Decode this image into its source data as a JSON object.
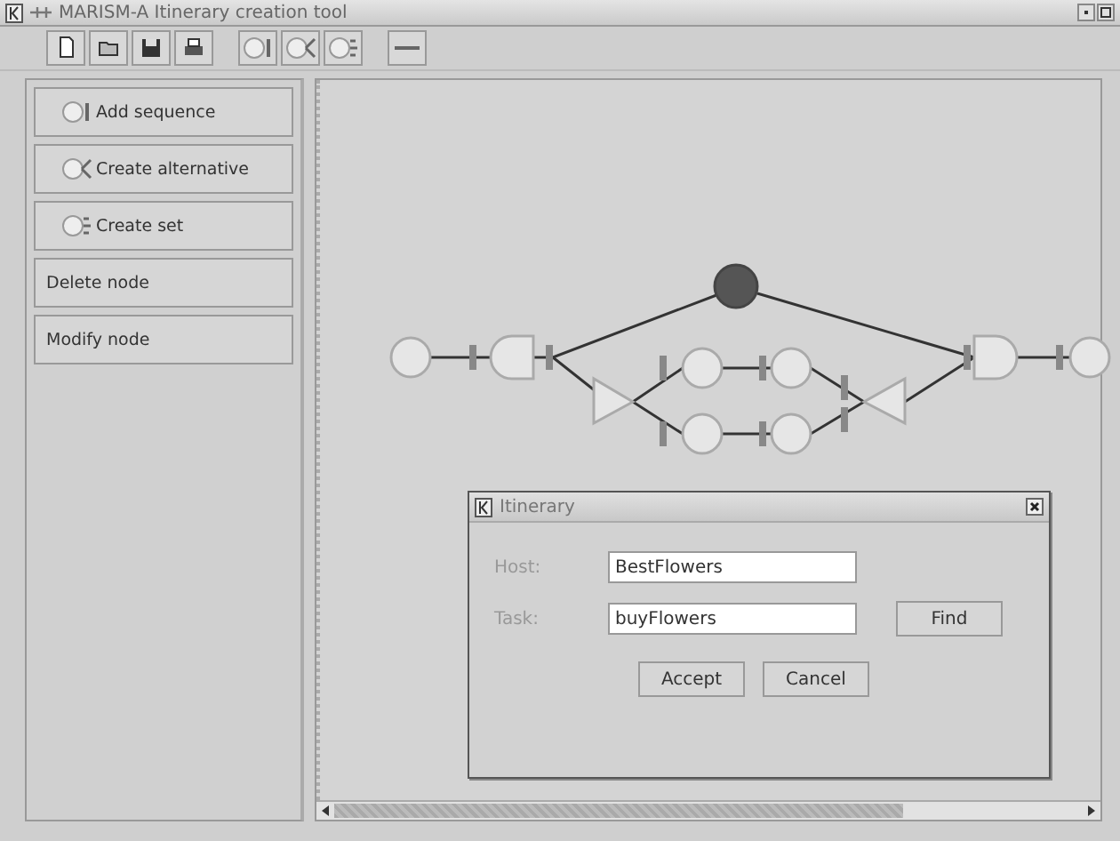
{
  "window": {
    "title": "MARISM-A Itinerary creation tool"
  },
  "sidebar": {
    "items": [
      {
        "label": "Add sequence",
        "kind": "sequence"
      },
      {
        "label": "Create alternative",
        "kind": "alternative"
      },
      {
        "label": "Create set",
        "kind": "set"
      },
      {
        "label": "Delete node",
        "kind": "plain"
      },
      {
        "label": "Modify node",
        "kind": "plain"
      }
    ]
  },
  "dialog": {
    "title": "Itinerary",
    "fields": [
      {
        "label": "Host:",
        "value": "BestFlowers"
      },
      {
        "label": "Task:",
        "value": "buyFlowers",
        "button": "Find"
      }
    ],
    "buttons": [
      "Accept",
      "Cancel"
    ]
  }
}
